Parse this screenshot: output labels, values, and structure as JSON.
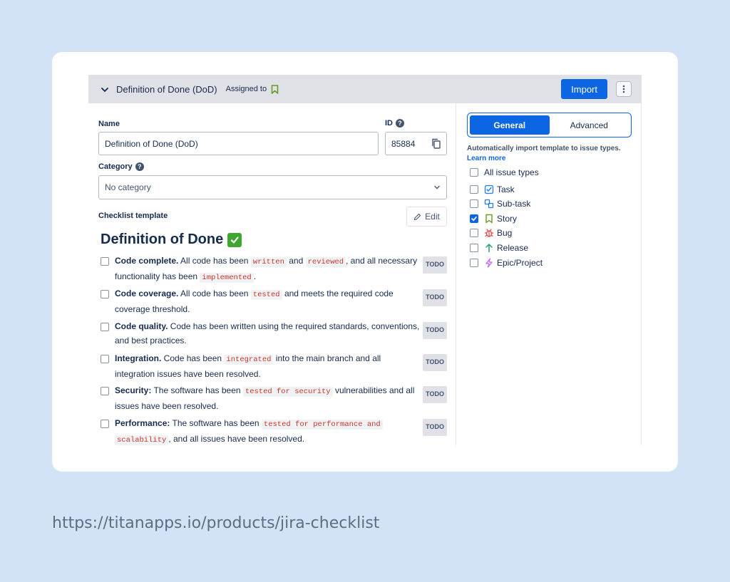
{
  "header": {
    "title": "Definition of Done (DoD)",
    "assigned_label": "Assigned to",
    "import_label": "Import"
  },
  "form": {
    "name_label": "Name",
    "name_value": "Definition of Done (DoD)",
    "id_label": "ID",
    "id_value": "85884",
    "category_label": "Category",
    "category_value": "No category",
    "template_label": "Checklist template",
    "edit_label": "Edit"
  },
  "template": {
    "title": "Definition of Done",
    "items": [
      {
        "bold": "Code complete.",
        "t1": " All code has been ",
        "c1": "written",
        "t2": " and ",
        "c2": "reviewed",
        "t3": ", and all necessary functionality has been ",
        "c3": "implemented",
        "t4": ".",
        "status": "TODO"
      },
      {
        "bold": "Code coverage.",
        "t1": " All code has been ",
        "c1": "tested",
        "t2": " and meets the required code coverage threshold.",
        "status": "TODO"
      },
      {
        "bold": "Code quality.",
        "t1": " Code has been written using the required standards, conventions, and best practices.",
        "status": "TODO"
      },
      {
        "bold": "Integration.",
        "t1": " Code has been ",
        "c1": "integrated",
        "t2": " into the main branch and all integration issues have been resolved.",
        "status": "TODO"
      },
      {
        "bold": "Security:",
        "t1": " The software has been ",
        "c1": "tested for security",
        "t2": " vulnerabilities and all issues have been resolved.",
        "status": "TODO"
      },
      {
        "bold": "Performance:",
        "t1": " The software has been ",
        "c1": "tested for performance and",
        "c2": "scalability",
        "t2": ", and all issues have been resolved.",
        "status": "TODO"
      }
    ]
  },
  "settings": {
    "tab_general": "General",
    "tab_advanced": "Advanced",
    "auto_text": "Automatically import template to issue types.",
    "learn_more": "Learn more",
    "issue_types": [
      {
        "label": "All issue types",
        "checked": false
      },
      {
        "label": "Task",
        "checked": false
      },
      {
        "label": "Sub-task",
        "checked": false
      },
      {
        "label": "Story",
        "checked": true
      },
      {
        "label": "Bug",
        "checked": false
      },
      {
        "label": "Release",
        "checked": false
      },
      {
        "label": "Epic/Project",
        "checked": false
      }
    ]
  },
  "colors": {
    "accent": "#0c66e4",
    "code_text": "#c9372c",
    "story_green": "#6a9a23",
    "bug_red": "#e2483d",
    "epic_purple": "#bf63f3",
    "release_green": "#22a06b"
  },
  "footer": {
    "url": "https://titanapps.io/products/jira-checklist"
  }
}
